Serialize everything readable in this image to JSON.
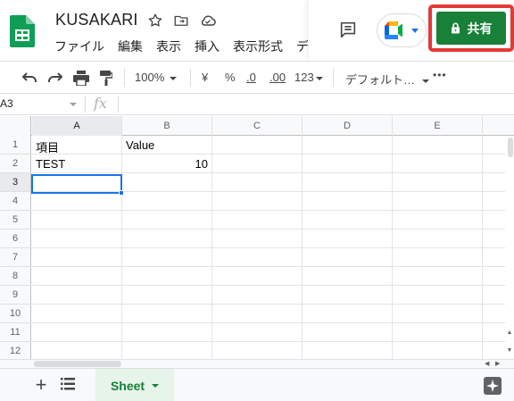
{
  "app": {
    "title": "KUSAKARI",
    "menu": [
      "ファイル",
      "編集",
      "表示",
      "挿入",
      "表示形式",
      "デ"
    ],
    "share_label": "共有",
    "colors": {
      "share_bg": "#188038",
      "highlight": "#e53935",
      "selection": "#1a73e8",
      "sheets_green": "#188038"
    }
  },
  "toolbar": {
    "zoom": "100%",
    "currency": "¥",
    "percent": "%",
    "dec_decrease": ".0",
    "dec_increase": ".00",
    "more_formats": "123",
    "font": "デフォルト…",
    "more": "•••"
  },
  "formula_bar": {
    "cell_ref": "A3",
    "fx": "fx",
    "value": ""
  },
  "grid": {
    "columns": [
      "A",
      "B",
      "C",
      "D",
      "E"
    ],
    "selected_column": "A",
    "selected_row": "3",
    "rows": [
      {
        "num": "1",
        "cells": [
          "項目",
          "Value",
          "",
          "",
          ""
        ]
      },
      {
        "num": "2",
        "cells": [
          "TEST",
          "10",
          "",
          "",
          ""
        ]
      },
      {
        "num": "3",
        "cells": [
          "",
          "",
          "",
          "",
          ""
        ]
      },
      {
        "num": "4",
        "cells": [
          "",
          "",
          "",
          "",
          ""
        ]
      },
      {
        "num": "5",
        "cells": [
          "",
          "",
          "",
          "",
          ""
        ]
      },
      {
        "num": "6",
        "cells": [
          "",
          "",
          "",
          "",
          ""
        ]
      },
      {
        "num": "7",
        "cells": [
          "",
          "",
          "",
          "",
          ""
        ]
      },
      {
        "num": "8",
        "cells": [
          "",
          "",
          "",
          "",
          ""
        ]
      },
      {
        "num": "9",
        "cells": [
          "",
          "",
          "",
          "",
          ""
        ]
      },
      {
        "num": "10",
        "cells": [
          "",
          "",
          "",
          "",
          ""
        ]
      },
      {
        "num": "11",
        "cells": [
          "",
          "",
          "",
          "",
          ""
        ]
      },
      {
        "num": "12",
        "cells": [
          "",
          "",
          "",
          "",
          ""
        ]
      }
    ]
  },
  "sheets": {
    "tabs": [
      "Sheet"
    ],
    "active": "Sheet"
  }
}
